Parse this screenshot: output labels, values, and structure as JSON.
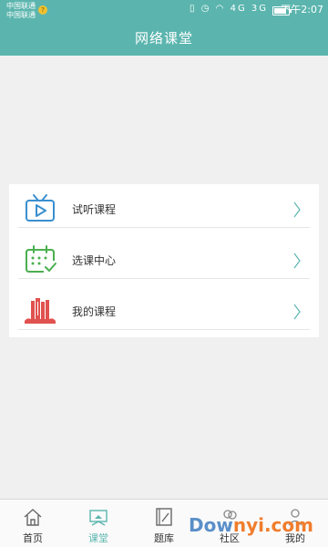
{
  "status_bar": {
    "carrier_1": "中国联通",
    "carrier_2": "中国联通",
    "signal_labels": "4G 3G",
    "battery_level": 0.85,
    "time": "下午2:07"
  },
  "header": {
    "title": "网络课堂"
  },
  "menu": [
    {
      "label": "试听课程",
      "icon": "tv-icon",
      "color": "#3a8fcf"
    },
    {
      "label": "选课中心",
      "icon": "calendar-icon",
      "color": "#4caf50"
    },
    {
      "label": "我的课程",
      "icon": "books-icon",
      "color": "#e0524f"
    }
  ],
  "bottom_nav": [
    {
      "label": "首页",
      "icon": "home-icon"
    },
    {
      "label": "课堂",
      "icon": "classroom-icon",
      "active": true
    },
    {
      "label": "题库",
      "icon": "question-bank-icon"
    },
    {
      "label": "社区",
      "icon": "community-icon"
    },
    {
      "label": "我的",
      "icon": "profile-icon"
    }
  ],
  "colors": {
    "primary": "#5bb5ae",
    "watermark_orange": "#f07d2d",
    "watermark_blue": "#5a8fc8"
  },
  "watermark": {
    "prefix": "Dow",
    "suffix": "nyi.com"
  }
}
